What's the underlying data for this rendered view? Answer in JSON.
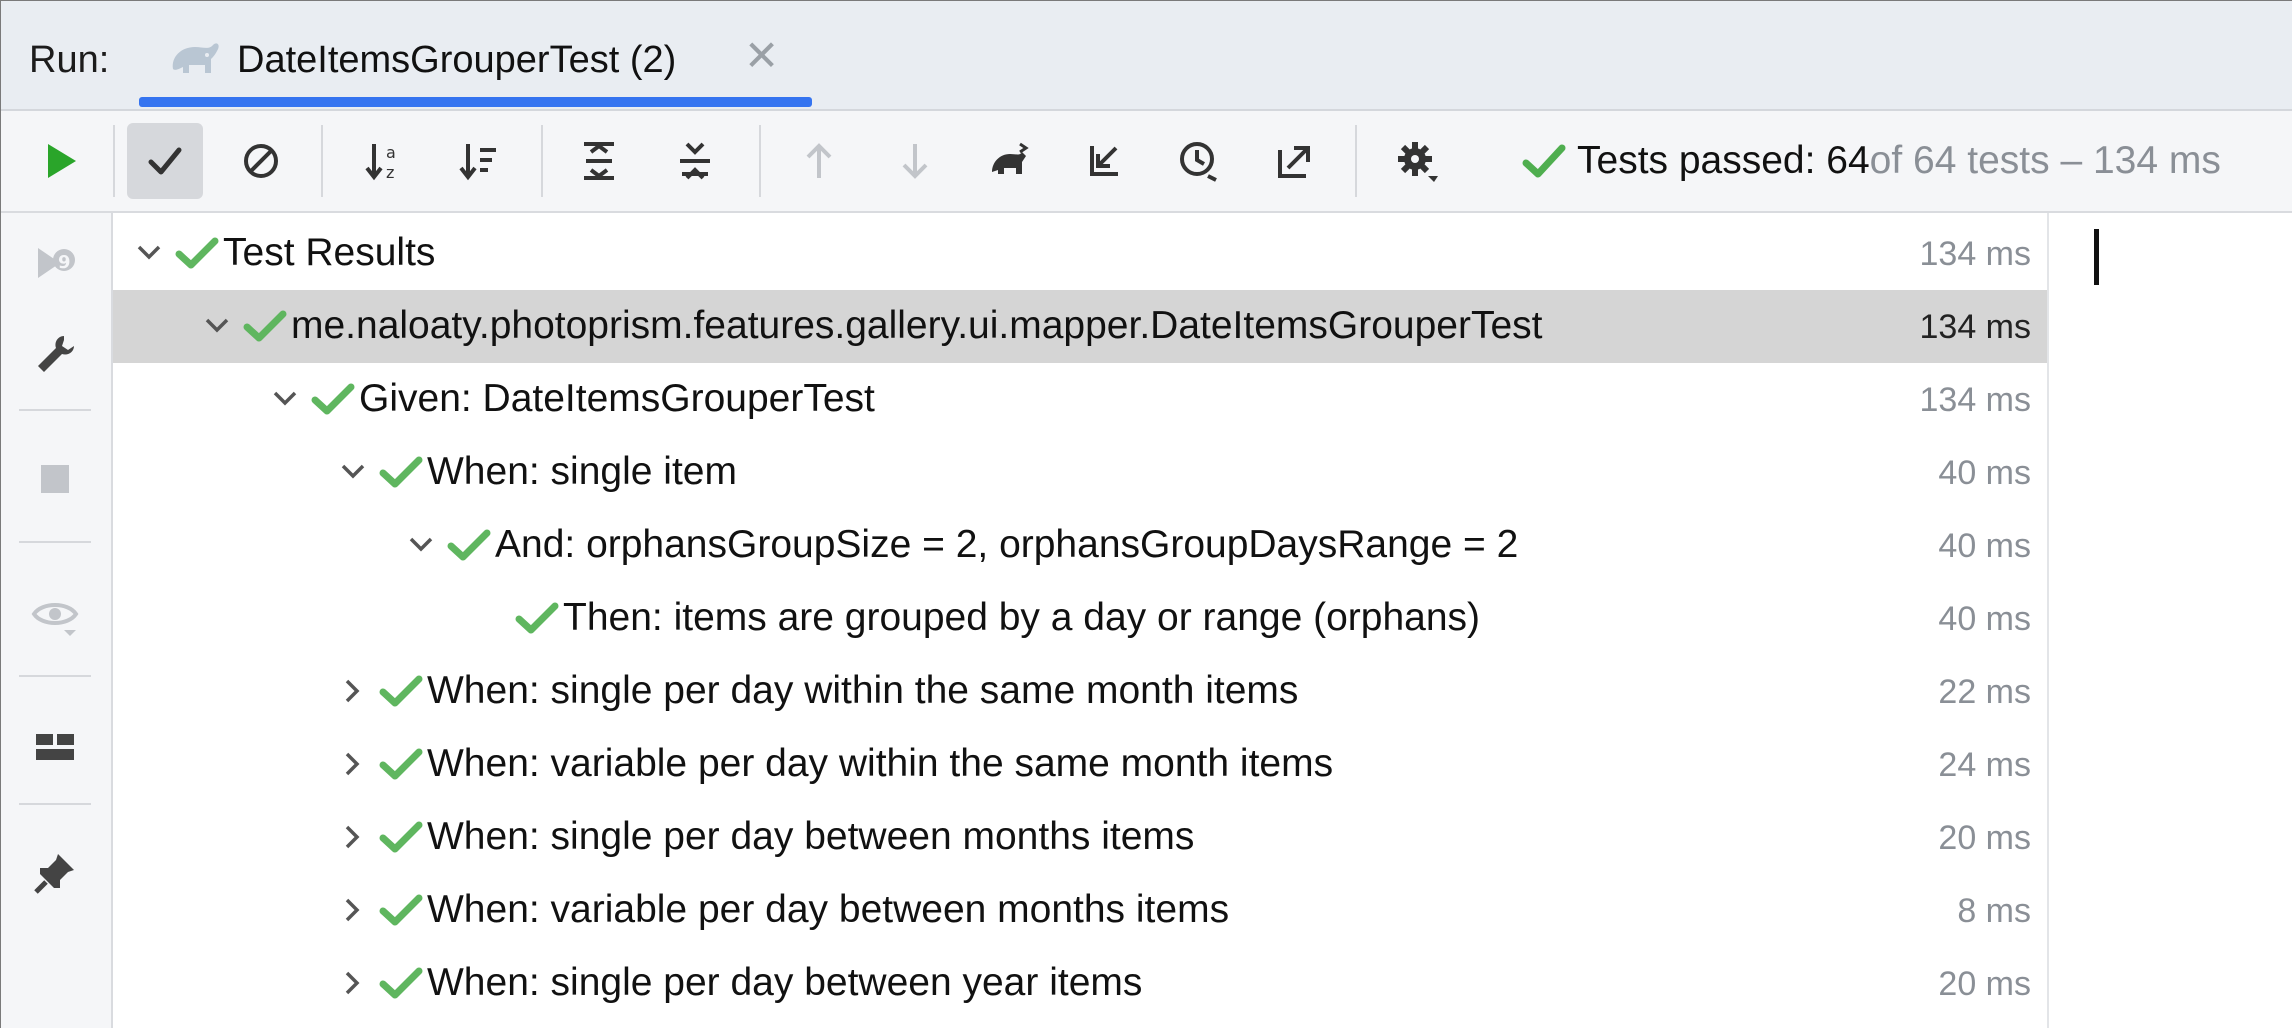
{
  "run_label": "Run:",
  "tab": {
    "title": "DateItemsGrouperTest (2)",
    "close": "✕"
  },
  "colors": {
    "pass_green": "#5fb65f",
    "run_green": "#2aa52a",
    "accent": "#3574f0"
  },
  "toolbar": {
    "buttons": [
      "run-icon",
      "show-passed-icon",
      "show-ignored-icon",
      "sort-alphabetically-icon",
      "sort-by-duration-icon",
      "expand-all-icon",
      "collapse-all-icon",
      "previous-failed-icon",
      "next-failed-icon",
      "run-with-coverage-icon",
      "import-tests-icon",
      "test-history-icon",
      "export-results-icon",
      "settings-icon"
    ],
    "status": {
      "passed": "Tests passed: 64",
      "of": " of 64 tests – 134 ms"
    }
  },
  "sidebar": [
    "rerun-failed-icon",
    "wrench-icon",
    "stop-icon",
    "view-icon",
    "layout-icon",
    "pin-icon"
  ],
  "tree": [
    {
      "label": "Test Results",
      "time": "134 ms",
      "expanded": true,
      "level": 0
    },
    {
      "label": "me.naloaty.photoprism.features.gallery.ui.mapper.DateItemsGrouperTest",
      "time": "134 ms",
      "expanded": true,
      "level": 1,
      "selected": true
    },
    {
      "label": "Given: DateItemsGrouperTest",
      "time": "134 ms",
      "expanded": true,
      "level": 2
    },
    {
      "label": "When: single item",
      "time": "40 ms",
      "expanded": true,
      "level": 3
    },
    {
      "label": "And: orphansGroupSize = 2, orphansGroupDaysRange = 2",
      "time": "40 ms",
      "expanded": true,
      "level": 4
    },
    {
      "label": "Then: items are grouped by a day or range (orphans)",
      "time": "40 ms",
      "level": 5
    },
    {
      "label": "When: single per day within the same month items",
      "time": "22 ms",
      "expanded": false,
      "level": 3
    },
    {
      "label": "When: variable per day within the same month items",
      "time": "24 ms",
      "expanded": false,
      "level": 3
    },
    {
      "label": "When: single per day between months items",
      "time": "20 ms",
      "expanded": false,
      "level": 3
    },
    {
      "label": "When: variable per day between months items",
      "time": "8 ms",
      "expanded": false,
      "level": 3
    },
    {
      "label": "When: single per day between year items",
      "time": "20 ms",
      "expanded": false,
      "level": 3
    }
  ]
}
